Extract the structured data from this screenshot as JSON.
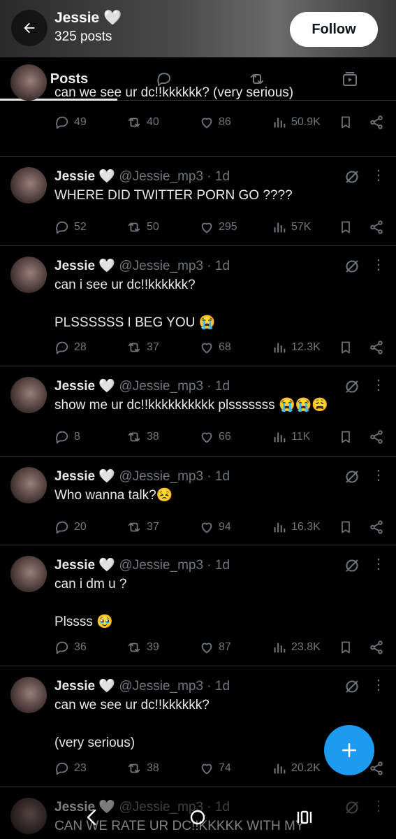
{
  "header": {
    "name": "Jessie 🤍",
    "post_count": "325 posts",
    "follow_label": "Follow"
  },
  "tabs": [
    {
      "label": "Posts",
      "icon": "posts-icon",
      "active": true
    },
    {
      "label": "",
      "icon": "replies-icon"
    },
    {
      "label": "",
      "icon": "retweets-icon"
    },
    {
      "label": "",
      "icon": "video-icon"
    }
  ],
  "partial_tweet": {
    "text": "can we see ur dc!!kkkkkk? (very serious)",
    "replies": "49",
    "reposts": "40",
    "likes": "86",
    "views": "50.9K"
  },
  "tweets": [
    {
      "name": "Jessie",
      "heart": "🤍",
      "handle": "@Jessie_mp3 · 1d",
      "text": "WHERE DID TWITTER PORN GO ????",
      "replies": "52",
      "reposts": "50",
      "likes": "295",
      "views": "57K"
    },
    {
      "name": "Jessie",
      "heart": "🤍",
      "handle": "@Jessie_mp3 · 1d",
      "text": "can i see ur dc!!kkkkkk?\n\nPLSSSSSS I BEG YOU 😭",
      "replies": "28",
      "reposts": "37",
      "likes": "68",
      "views": "12.3K"
    },
    {
      "name": "Jessie",
      "heart": "🤍",
      "handle": "@Jessie_mp3 · 1d",
      "text": "show me ur dc!!kkkkkkkkkk plsssssss 😭😭😩",
      "replies": "8",
      "reposts": "38",
      "likes": "66",
      "views": "11K"
    },
    {
      "name": "Jessie",
      "heart": "🤍",
      "handle": "@Jessie_mp3 · 1d",
      "text": "Who wanna talk?😣",
      "replies": "20",
      "reposts": "37",
      "likes": "94",
      "views": "16.3K"
    },
    {
      "name": "Jessie",
      "heart": "🤍",
      "handle": "@Jessie_mp3 · 1d",
      "text": "can i dm u ?\n\nPlssss 🥹",
      "replies": "36",
      "reposts": "39",
      "likes": "87",
      "views": "23.8K"
    },
    {
      "name": "Jessie",
      "heart": "🤍",
      "handle": "@Jessie_mp3 · 1d",
      "text": "can we see ur dc!!kkkkkk?\n\n(very serious)",
      "replies": "23",
      "reposts": "38",
      "likes": "74",
      "views": "20.2K"
    },
    {
      "name": "Jessie",
      "heart": "🤍",
      "handle": "@Jessie_mp3 · 1d",
      "text": "CAN WE RATE UR DC!!KKKKK WITH MY"
    }
  ],
  "fab_icon": "compose-plus-icon",
  "navbar": [
    "back-nav-icon",
    "home-nav-icon",
    "recents-nav-icon"
  ],
  "colors": {
    "accent": "#1d9bf0",
    "muted": "#71767b",
    "text": "#e7e9ea",
    "divider": "#2f3336"
  }
}
